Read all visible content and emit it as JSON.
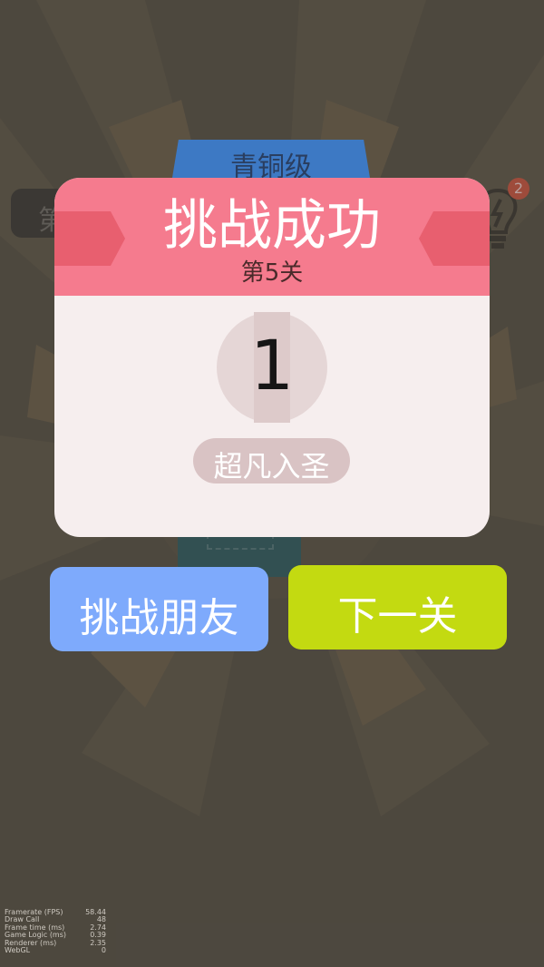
{
  "game": {
    "rank_label": "青铜级",
    "left_pill_char": "第",
    "hint_badge_count": "2",
    "modal": {
      "title": "挑战成功",
      "level": "第5关",
      "count": "1",
      "achievement": "超凡入圣"
    },
    "buttons": {
      "challenge_friend": "挑战朋友",
      "next_level": "下一关"
    }
  },
  "debug_stats": [
    {
      "label": "Framerate (FPS)",
      "value": "58.44"
    },
    {
      "label": "Draw Call",
      "value": "48"
    },
    {
      "label": "Frame time (ms)",
      "value": "2.74"
    },
    {
      "label": "Game Logic (ms)",
      "value": "0.39"
    },
    {
      "label": "Renderer (ms)",
      "value": "2.35"
    },
    {
      "label": "WebGL",
      "value": "0"
    }
  ],
  "colors": {
    "background": "#554f44",
    "rank_tab": "#3d79c4",
    "modal_header": "#f57b8e",
    "modal_body": "#f6eeee",
    "button_friend": "#7eaafc",
    "button_next": "#c3da11"
  }
}
